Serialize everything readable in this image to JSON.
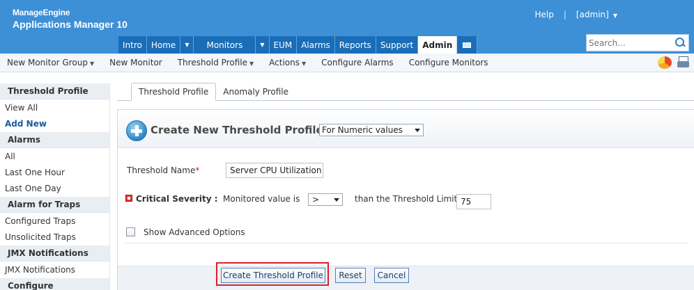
{
  "brand": {
    "vendor": "ManageEngine",
    "product": "Applications Manager 10"
  },
  "header_links": {
    "help": "Help",
    "separator": "|",
    "user": "[admin]"
  },
  "nav": {
    "tabs": [
      "Intro",
      "Home",
      "Monitors",
      "EUM",
      "Alarms",
      "Reports",
      "Support",
      "Admin"
    ],
    "active": "Admin"
  },
  "search": {
    "placeholder": "Search..."
  },
  "toolbar": {
    "items": [
      "New Monitor Group",
      "New Monitor",
      "Threshold Profile",
      "Actions",
      "Configure Alarms",
      "Configure Monitors"
    ]
  },
  "sidebar": {
    "sections": [
      {
        "title": "Threshold Profile",
        "items": [
          "View All",
          "Add New"
        ]
      },
      {
        "title": "Alarms",
        "items": [
          "All",
          "Last One Hour",
          "Last One Day"
        ]
      },
      {
        "title": "Alarm for Traps",
        "items": [
          "Configured Traps",
          "Unsolicited Traps"
        ]
      },
      {
        "title": "JMX Notifications",
        "items": [
          "JMX Notifications"
        ]
      },
      {
        "title": "Configure",
        "items": []
      }
    ],
    "active_item": "Add New"
  },
  "profile_tabs": [
    "Threshold Profile",
    "Anomaly Profile"
  ],
  "form": {
    "title": "Create New Threshold Profile",
    "type_select": "For Numeric values",
    "threshold_name_label": "Threshold Name",
    "required_mark": "*",
    "threshold_name_value": "Server CPU Utilization",
    "critical_label": "Critical Severity :",
    "monitored_label": "Monitored value is",
    "operator": ">",
    "than_label": "than the Threshold Limit",
    "limit_value": "75",
    "advanced_label": "Show Advanced Options",
    "advanced_checked": false
  },
  "buttons": {
    "create": "Create Threshold Profile",
    "reset": "Reset",
    "cancel": "Cancel"
  },
  "colors": {
    "header_bg": "#3d8fd6",
    "nav_tab_bg": "#1a6db7",
    "highlight_border": "#d9212b",
    "active_link": "#1a5a9c"
  }
}
